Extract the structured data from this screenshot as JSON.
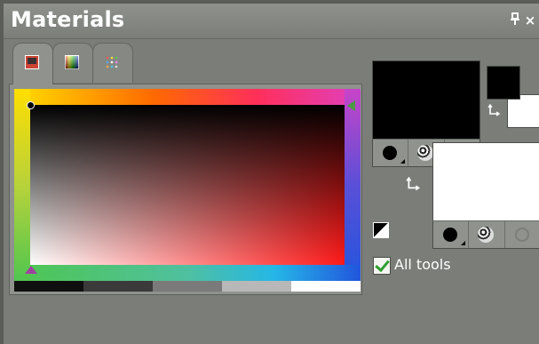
{
  "window": {
    "title": "Materials",
    "pin_glyph": "ᵖ",
    "close_glyph": "×"
  },
  "tabs": [
    {
      "name": "frame-tab",
      "icon": "frame-swatch-icon",
      "active": true
    },
    {
      "name": "rainbow-tab",
      "icon": "rainbow-swatches-icon",
      "active": false
    },
    {
      "name": "swatches-tab",
      "icon": "dot-swatches-icon",
      "active": false
    }
  ],
  "picker": {
    "gray_steps": [
      "#0f0f0f",
      "#3a3a3a",
      "#7a7a7a",
      "#b8b8b8",
      "#ffffff"
    ],
    "hue_colors": [
      "#ffde00",
      "#ff6a00",
      "#ff2f2f",
      "#e040c0",
      "#2255dd",
      "#25b7e7",
      "#5fd14d",
      "#d3d62a"
    ]
  },
  "foreground": {
    "color": "#000000"
  },
  "background": {
    "color": "#ffffff"
  },
  "swap_glyph": "⮂",
  "all_tools": {
    "label": "All tools",
    "checked": true
  }
}
